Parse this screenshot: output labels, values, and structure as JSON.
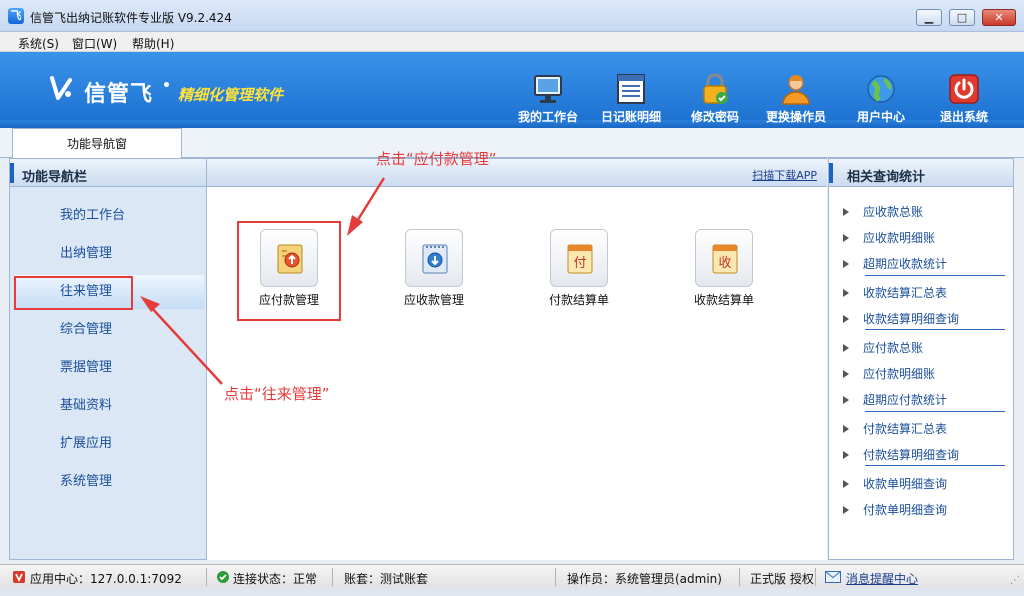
{
  "window": {
    "title": "信管飞出纳记账软件专业版 V9.2.424",
    "minimize": "▁",
    "maximize": "□",
    "close": "✕"
  },
  "menu": [
    "系统(S)",
    "窗口(W)",
    "帮助(H)"
  ],
  "brand": {
    "name": "信管飞",
    "slogan": "精细化管理软件"
  },
  "toolbar": [
    {
      "label": "我的工作台",
      "icon": "monitor-icon"
    },
    {
      "label": "日记账明细",
      "icon": "ledger-icon"
    },
    {
      "label": "修改密码",
      "icon": "lock-icon"
    },
    {
      "label": "更换操作员",
      "icon": "user-icon"
    },
    {
      "label": "用户中心",
      "icon": "globe-icon"
    },
    {
      "label": "退出系统",
      "icon": "power-icon"
    }
  ],
  "tab": "功能导航窗",
  "left_panel": {
    "title": "功能导航栏",
    "items": [
      "我的工作台",
      "出纳管理",
      "往来管理",
      "综合管理",
      "票据管理",
      "基础资料",
      "扩展应用",
      "系统管理"
    ],
    "active": "往来管理"
  },
  "center": {
    "scan_link": "扫描下载APP",
    "functions": [
      {
        "label": "应付款管理",
        "icon": "payable-icon"
      },
      {
        "label": "应收款管理",
        "icon": "receivable-icon"
      },
      {
        "label": "付款结算单",
        "icon": "payment-slip-icon",
        "glyph": "付"
      },
      {
        "label": "收款结算单",
        "icon": "receipt-slip-icon",
        "glyph": "收"
      }
    ]
  },
  "right_panel": {
    "title": "相关查询统计",
    "items": [
      "应收款总账",
      "应收款明细账",
      "超期应收款统计",
      "收款结算汇总表",
      "收款结算明细查询",
      "应付款总账",
      "应付款明细账",
      "超期应付款统计",
      "付款结算汇总表",
      "付款结算明细查询",
      "收款单明细查询",
      "付款单明细查询"
    ]
  },
  "statusbar": {
    "app_center": "应用中心：127.0.0.1:7092",
    "connection": "连接状态：正常",
    "account": "账套：测试账套",
    "operator": "操作员：系统管理员(admin)",
    "edition": "正式版 授权",
    "message": "消息提醒中心"
  },
  "annotations": {
    "top": "点击“应付款管理”",
    "left": "点击“往来管理”"
  },
  "colors": {
    "accent": "#1b6fcf",
    "annotation": "#e53b3b",
    "link": "#1b4f9a"
  }
}
